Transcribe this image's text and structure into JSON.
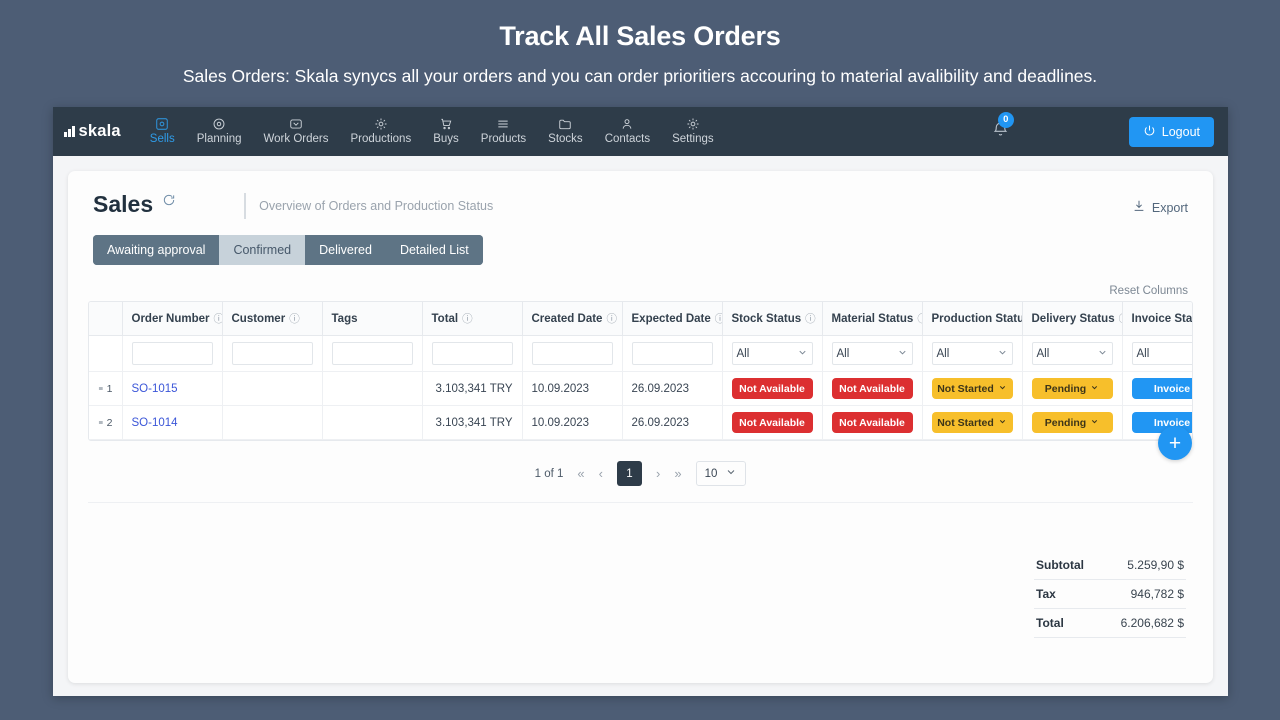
{
  "promo": {
    "title": "Track All Sales Orders",
    "subtitle": "Sales Orders: Skala synycs all your orders and you can order prioritiers accouring to material avalibility and deadlines."
  },
  "nav": {
    "logo_text": "skala",
    "items": [
      {
        "label": "Sells",
        "icon": "sells-icon",
        "active": true
      },
      {
        "label": "Planning",
        "icon": "planning-icon",
        "active": false
      },
      {
        "label": "Work Orders",
        "icon": "work-orders-icon",
        "active": false
      },
      {
        "label": "Productions",
        "icon": "productions-icon",
        "active": false
      },
      {
        "label": "Buys",
        "icon": "buys-icon",
        "active": false
      },
      {
        "label": "Products",
        "icon": "products-icon",
        "active": false
      },
      {
        "label": "Stocks",
        "icon": "stocks-icon",
        "active": false
      },
      {
        "label": "Contacts",
        "icon": "contacts-icon",
        "active": false
      },
      {
        "label": "Settings",
        "icon": "settings-icon",
        "active": false
      }
    ],
    "notification_count": "0",
    "logout_label": "Logout"
  },
  "page": {
    "title": "Sales",
    "subtitle": "Overview of Orders and Production Status",
    "export_label": "Export",
    "reset_columns_label": "Reset Columns"
  },
  "tabs": [
    {
      "label": "Awaiting approval",
      "selected": false
    },
    {
      "label": "Confirmed",
      "selected": true
    },
    {
      "label": "Delivered",
      "selected": false
    },
    {
      "label": "Detailed List",
      "selected": false
    }
  ],
  "table": {
    "columns": [
      {
        "label": "Order Number",
        "info": true
      },
      {
        "label": "Customer",
        "info": true
      },
      {
        "label": "Tags",
        "info": false
      },
      {
        "label": "Total",
        "info": true
      },
      {
        "label": "Created Date",
        "info": true
      },
      {
        "label": "Expected Date",
        "info": true
      },
      {
        "label": "Stock Status",
        "info": true
      },
      {
        "label": "Material Status",
        "info": true
      },
      {
        "label": "Production Status",
        "info": true
      },
      {
        "label": "Delivery Status",
        "info": true
      },
      {
        "label": "Invoice Status",
        "info": false
      }
    ],
    "filters": {
      "order_number": "",
      "customer": "",
      "tags": "",
      "total": "",
      "created_date": "",
      "expected_date": "",
      "stock_status": "All",
      "material_status": "All",
      "production_status": "All",
      "delivery_status": "All",
      "invoice_status": "All"
    },
    "rows": [
      {
        "index": "1",
        "order_number": "SO-1015",
        "customer": "",
        "tags": "",
        "total": "3.103,341 TRY",
        "created_date": "10.09.2023",
        "expected_date": "26.09.2023",
        "stock_status": "Not Available",
        "material_status": "Not Available",
        "production_status": "Not Started",
        "delivery_status": "Pending",
        "invoice_status": "Invoice"
      },
      {
        "index": "2",
        "order_number": "SO-1014",
        "customer": "",
        "tags": "",
        "total": "3.103,341 TRY",
        "created_date": "10.09.2023",
        "expected_date": "26.09.2023",
        "stock_status": "Not Available",
        "material_status": "Not Available",
        "production_status": "Not Started",
        "delivery_status": "Pending",
        "invoice_status": "Invoice"
      }
    ]
  },
  "pagination": {
    "summary": "1 of 1",
    "first": "«",
    "prev": "‹",
    "current_page": "1",
    "next": "›",
    "last": "»",
    "page_size": "10"
  },
  "totals": [
    {
      "label": "Subtotal",
      "value": "5.259,90 $"
    },
    {
      "label": "Tax",
      "value": "946,782 $"
    },
    {
      "label": "Total",
      "value": "6.206,682 $"
    }
  ],
  "fab": {
    "label": "+"
  },
  "colors": {
    "page_background": "#4d5d75",
    "nav_background": "#2e3c49",
    "accent_blue": "#2196f3",
    "badge_red": "#dc2f31",
    "badge_amber": "#f7bf2b",
    "tab_background": "#5e7485",
    "tab_selected": "#c7d2da"
  }
}
